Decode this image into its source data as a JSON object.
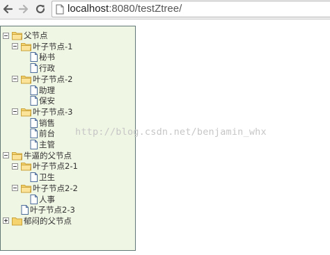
{
  "browser": {
    "back_icon": "back-arrow-icon",
    "forward_icon": "forward-arrow-icon",
    "reload_icon": "reload-icon",
    "url_host": "localhost",
    "url_path": ":8080/testZtree/"
  },
  "tree": {
    "nodes": [
      {
        "label": "父节点",
        "icon": "folder-open-icon",
        "expander": "collapse"
      },
      {
        "label": "叶子节点-1",
        "icon": "folder-open-icon",
        "expander": "collapse"
      },
      {
        "label": "秘书",
        "icon": "document-icon"
      },
      {
        "label": "行政",
        "icon": "document-icon"
      },
      {
        "label": "叶子节点-2",
        "icon": "folder-open-icon",
        "expander": "collapse"
      },
      {
        "label": "助理",
        "icon": "document-icon"
      },
      {
        "label": "保安",
        "icon": "document-icon"
      },
      {
        "label": "叶子节点-3",
        "icon": "folder-open-icon",
        "expander": "collapse"
      },
      {
        "label": "销售",
        "icon": "document-icon"
      },
      {
        "label": "前台",
        "icon": "document-icon"
      },
      {
        "label": "主管",
        "icon": "document-icon"
      },
      {
        "label": "牛逼的父节点",
        "icon": "folder-open-icon",
        "expander": "collapse"
      },
      {
        "label": "叶子节点2-1",
        "icon": "folder-open-icon",
        "expander": "collapse"
      },
      {
        "label": "卫生",
        "icon": "document-icon"
      },
      {
        "label": "叶子节点2-2",
        "icon": "folder-open-icon",
        "expander": "collapse"
      },
      {
        "label": "人事",
        "icon": "document-icon"
      },
      {
        "label": "叶子节点2-3",
        "icon": "document-icon"
      },
      {
        "label": "郁闷的父节点",
        "icon": "folder-closed-icon",
        "expander": "expand"
      }
    ]
  },
  "watermark": "http://blog.csdn.net/benjamin_whx",
  "colors": {
    "tree_background": "#f0f6e4",
    "tree_border": "#617775",
    "folder": "#f5d36f",
    "url_bar": "#f2f2f2"
  }
}
